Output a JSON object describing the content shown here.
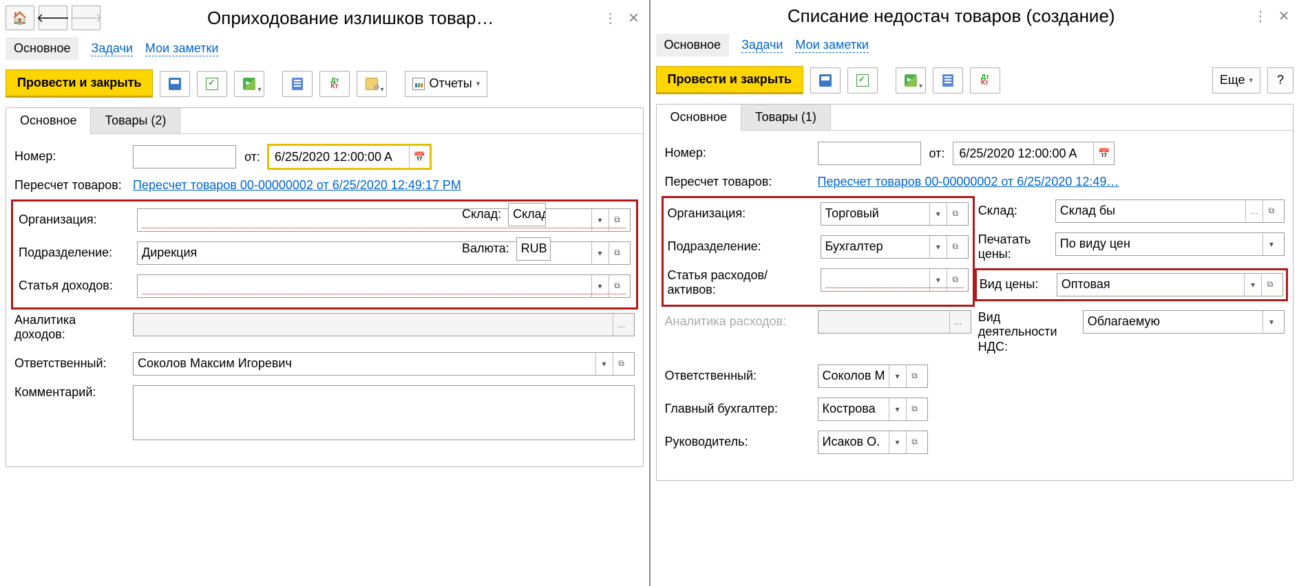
{
  "left": {
    "title": "Оприходование излишков товар…",
    "nav": {
      "main": "Основное",
      "tasks": "Задачи",
      "notes": "Мои заметки"
    },
    "toolbar": {
      "post_close": "Провести и закрыть",
      "reports": "Отчеты"
    },
    "tabs": {
      "main": "Основное",
      "goods": "Товары (2)"
    },
    "fields": {
      "number_lbl": "Номер:",
      "number_val": "",
      "from_lbl": "от:",
      "date_val": "6/25/2020 12:00:00 A",
      "recount_lbl": "Пересчет товаров:",
      "recount_link": "Пересчет товаров 00-00000002 от 6/25/2020 12:49:17 PM",
      "org_lbl": "Организация:",
      "org_val": "",
      "warehouse_lbl": "Склад:",
      "warehouse_val": "Склад",
      "dept_lbl": "Подразделение:",
      "dept_val": "Дирекция",
      "currency_lbl": "Валюта:",
      "currency_val": "RUB",
      "income_item_lbl": "Статья доходов:",
      "income_item_val": "",
      "income_anal_lbl": "Аналитика доходов:",
      "income_anal_val": "",
      "resp_lbl": "Ответственный:",
      "resp_val": "Соколов Максим Игоревич",
      "comment_lbl": "Комментарий:",
      "comment_val": ""
    }
  },
  "right": {
    "title": "Списание недостач товаров (создание)",
    "nav": {
      "main": "Основное",
      "tasks": "Задачи",
      "notes": "Мои заметки"
    },
    "toolbar": {
      "post_close": "Провести и закрыть",
      "more": "Еще",
      "help": "?"
    },
    "tabs": {
      "main": "Основное",
      "goods": "Товары (1)"
    },
    "fields": {
      "number_lbl": "Номер:",
      "number_val": "",
      "from_lbl": "от:",
      "date_val": "6/25/2020 12:00:00 A",
      "recount_lbl": "Пересчет товаров:",
      "recount_link": "Пересчет товаров 00-00000002 от 6/25/2020 12:49…",
      "org_lbl": "Организация:",
      "org_val": "Торговый",
      "warehouse_lbl": "Склад:",
      "warehouse_val": "Склад бы",
      "dept_lbl": "Подразделение:",
      "dept_val": "Бухгалтер",
      "print_lbl": "Печатать цены:",
      "print_val": "По виду цен",
      "expense_item_lbl": "Статья расходов/ активов:",
      "expense_item_val": "",
      "price_type_lbl": "Вид цены:",
      "price_type_val": "Оптовая",
      "expense_anal_lbl": "Аналитика расходов:",
      "expense_anal_val": "",
      "vat_lbl": "Вид деятельности НДС:",
      "vat_val": "Облагаемую",
      "resp_lbl": "Ответственный:",
      "resp_val": "Соколов М",
      "chief_acc_lbl": "Главный бухгалтер:",
      "chief_acc_val": "Кострова",
      "director_lbl": "Руководитель:",
      "director_val": "Исаков О."
    }
  }
}
